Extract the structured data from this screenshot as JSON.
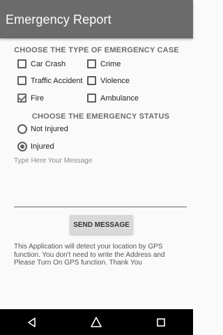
{
  "app_bar": {
    "title": "Emergency Report"
  },
  "case_section": {
    "title": "CHOOSE THE TYPE OF EMERGENCY CASE",
    "options": [
      {
        "label": "Car Crash",
        "checked": false
      },
      {
        "label": "Crime",
        "checked": false
      },
      {
        "label": "Traffic Accident",
        "checked": false
      },
      {
        "label": "Violence",
        "checked": false
      },
      {
        "label": "Fire",
        "checked": true
      },
      {
        "label": "Ambulance",
        "checked": false
      }
    ]
  },
  "status_section": {
    "title": "CHOOSE THE EMERGENCY STATUS",
    "options": [
      {
        "label": "Not Injured",
        "selected": false
      },
      {
        "label": "Injured",
        "selected": true
      }
    ]
  },
  "message": {
    "placeholder": "Type Here Your Message",
    "value": ""
  },
  "send_button": {
    "label": "SEND MESSAGE"
  },
  "info_text": "This Application will detect your location by GPS function. You don't need to write the Address and Please Turn On GPS function.         Thank You",
  "nav_bar": {
    "back": "back-icon",
    "home": "home-icon",
    "recents": "recents-icon"
  }
}
